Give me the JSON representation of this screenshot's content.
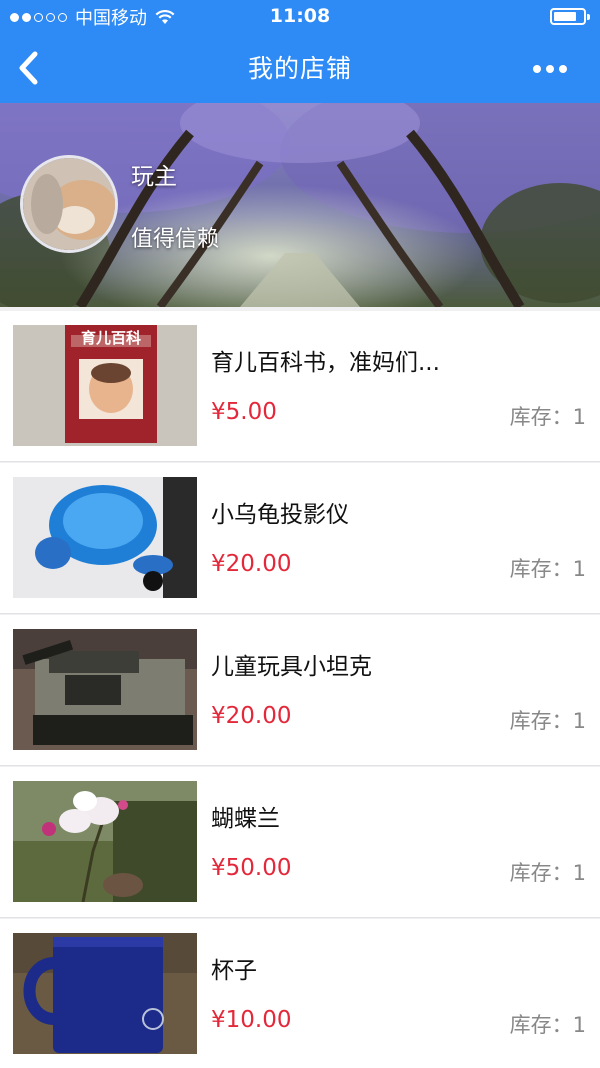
{
  "status_bar": {
    "carrier": "中国移动",
    "time": "11:08"
  },
  "nav": {
    "title": "我的店铺",
    "back_icon": "chevron-left-icon",
    "more_icon": "more-dots-icon"
  },
  "profile": {
    "name": "玩主",
    "tagline": "值得信赖"
  },
  "colors": {
    "nav_bg": "#2e8af4",
    "price": "#e4283b",
    "stock": "#888888"
  },
  "products": [
    {
      "name": "育儿百科书，准妈们...",
      "price": "¥5.00",
      "stock": "库存：1"
    },
    {
      "name": "小乌龟投影仪",
      "price": "¥20.00",
      "stock": "库存：1"
    },
    {
      "name": "儿童玩具小坦克",
      "price": "¥20.00",
      "stock": "库存：1"
    },
    {
      "name": "蝴蝶兰",
      "price": "¥50.00",
      "stock": "库存：1"
    },
    {
      "name": "杯子",
      "price": "¥10.00",
      "stock": "库存：1"
    }
  ]
}
